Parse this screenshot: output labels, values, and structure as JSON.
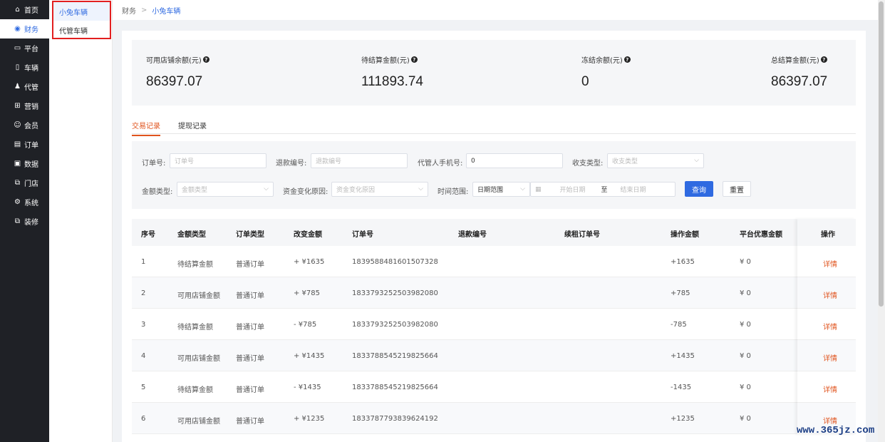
{
  "nav": {
    "items": [
      {
        "label": "首页",
        "icon": "home-icon",
        "glyph": "⌂"
      },
      {
        "label": "财务",
        "icon": "finance-icon",
        "glyph": "◉",
        "active": true
      },
      {
        "label": "平台",
        "icon": "platform-icon",
        "glyph": "▭"
      },
      {
        "label": "车辆",
        "icon": "vehicle-icon",
        "glyph": "▯"
      },
      {
        "label": "代管",
        "icon": "agent-icon",
        "glyph": "♟"
      },
      {
        "label": "营销",
        "icon": "gift-icon",
        "glyph": "⊞"
      },
      {
        "label": "会员",
        "icon": "member-icon",
        "glyph": "☺"
      },
      {
        "label": "订单",
        "icon": "order-icon",
        "glyph": "▤"
      },
      {
        "label": "数据",
        "icon": "data-icon",
        "glyph": "▣"
      },
      {
        "label": "门店",
        "icon": "store-icon",
        "glyph": "⧉"
      },
      {
        "label": "系统",
        "icon": "settings-icon",
        "glyph": "⚙"
      },
      {
        "label": "装修",
        "icon": "decorate-icon",
        "glyph": "⧉"
      }
    ]
  },
  "subnav": {
    "items": [
      {
        "label": "小兔车辆",
        "active": true
      },
      {
        "label": "代管车辆"
      }
    ]
  },
  "breadcrumb": {
    "root": "财务",
    "current": "小兔车辆"
  },
  "stats": [
    {
      "label": "可用店铺余额(元)",
      "value": "86397.07"
    },
    {
      "label": "待结算金额(元)",
      "value": "111893.74"
    },
    {
      "label": "冻结余额(元)",
      "value": "0"
    },
    {
      "label": "总结算金额(元)",
      "value": "86397.07"
    }
  ],
  "tabs": [
    {
      "label": "交易记录",
      "active": true
    },
    {
      "label": "提现记录"
    }
  ],
  "filter": {
    "order_no_label": "订单号:",
    "order_no_placeholder": "订单号",
    "refund_no_label": "退款编号:",
    "refund_no_placeholder": "退款编号",
    "phone_label": "代管人手机号:",
    "phone_value": "0",
    "type_label": "收支类型:",
    "type_placeholder": "收支类型",
    "amount_type_label": "金额类型:",
    "amount_type_placeholder": "金额类型",
    "reason_label": "资金变化原因:",
    "reason_placeholder": "资金变化原因",
    "time_label": "时间范围:",
    "time_range_value": "日期范围",
    "start_placeholder": "开始日期",
    "to_label": "至",
    "end_placeholder": "结束日期",
    "search_label": "查询",
    "reset_label": "重置"
  },
  "table": {
    "headers": [
      "序号",
      "金额类型",
      "订单类型",
      "改变金额",
      "订单号",
      "退款编号",
      "续租订单号",
      "操作金额",
      "平台优惠金额",
      "操作"
    ],
    "rows": [
      [
        "1",
        "待结算金额",
        "普通订单",
        "+ ¥1635",
        "1839588481601507328",
        "",
        "",
        "+1635",
        "¥ 0",
        "详情"
      ],
      [
        "2",
        "可用店铺金额",
        "普通订单",
        "+ ¥785",
        "1833793252503982080",
        "",
        "",
        "+785",
        "¥ 0",
        "详情"
      ],
      [
        "3",
        "待结算金额",
        "普通订单",
        "- ¥785",
        "1833793252503982080",
        "",
        "",
        "-785",
        "¥ 0",
        "详情"
      ],
      [
        "4",
        "可用店铺金额",
        "普通订单",
        "+ ¥1435",
        "1833788545219825664",
        "",
        "",
        "+1435",
        "¥ 0",
        "详情"
      ],
      [
        "5",
        "待结算金额",
        "普通订单",
        "- ¥1435",
        "1833788545219825664",
        "",
        "",
        "-1435",
        "¥ 0",
        "详情"
      ],
      [
        "6",
        "可用店铺金额",
        "普通订单",
        "+ ¥1235",
        "1833787793839624192",
        "",
        "",
        "+1235",
        "¥ 0",
        "详情"
      ]
    ]
  },
  "watermark": "www.365jz.com"
}
